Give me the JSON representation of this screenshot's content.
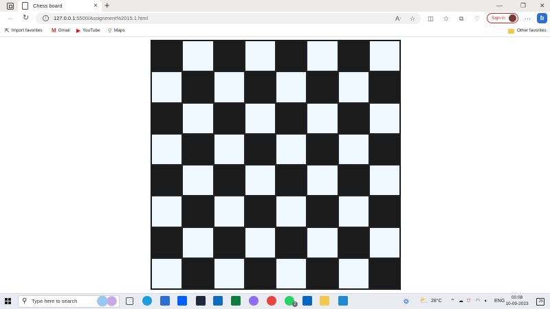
{
  "browser": {
    "tab_title": "Chess board",
    "tab_close": "×",
    "new_tab": "+",
    "url_host": "127.0.0.1",
    "url_rest": ":5500/Assignment%2015.1.html",
    "sign_in_label": "Sign in",
    "bing_label": "b",
    "window_controls": [
      "—",
      "❐",
      "✕"
    ]
  },
  "favorites": {
    "items": [
      {
        "label": "Import favorites",
        "icon": "import-icon"
      },
      {
        "label": "Gmail",
        "icon": "gmail-icon",
        "color": "#d93025"
      },
      {
        "label": "YouTube",
        "icon": "youtube-icon",
        "color": "#ff0000"
      },
      {
        "label": "Maps",
        "icon": "maps-icon",
        "color": "#34a853"
      }
    ],
    "other_favorites": "Other favorites"
  },
  "board": {
    "rows": 8,
    "cols": 8,
    "first_square": "dark",
    "dark_color": "#1b1b1b",
    "light_color": "#f0f8ff"
  },
  "taskbar": {
    "search_placeholder": "Type here to search",
    "apps": [
      {
        "name": "task-view-icon",
        "color": "#555555"
      },
      {
        "name": "edge-icon",
        "color": "#1b9de2"
      },
      {
        "name": "store-icon",
        "color": "#2b6fd6"
      },
      {
        "name": "dropbox-icon",
        "color": "#0061fe"
      },
      {
        "name": "terminal-icon",
        "color": "#1e2a3a"
      },
      {
        "name": "mail-icon",
        "color": "#0f6cbd"
      },
      {
        "name": "excel-icon",
        "color": "#107c41"
      },
      {
        "name": "copilot-icon",
        "color": "#8e6cf0"
      },
      {
        "name": "chrome-icon",
        "color": "#e8453c"
      },
      {
        "name": "whatsapp-icon",
        "color": "#25d366"
      },
      {
        "name": "linkedin-icon",
        "color": "#0a66c2"
      },
      {
        "name": "file-explorer-icon",
        "color": "#f2c94c"
      },
      {
        "name": "vscode-icon",
        "color": "#1f8ad2"
      }
    ],
    "whatsapp_badge": "2",
    "temperature": "28°C",
    "language": "ENG",
    "time": "00:08",
    "date": "10-09-2023",
    "notifications": "25"
  }
}
